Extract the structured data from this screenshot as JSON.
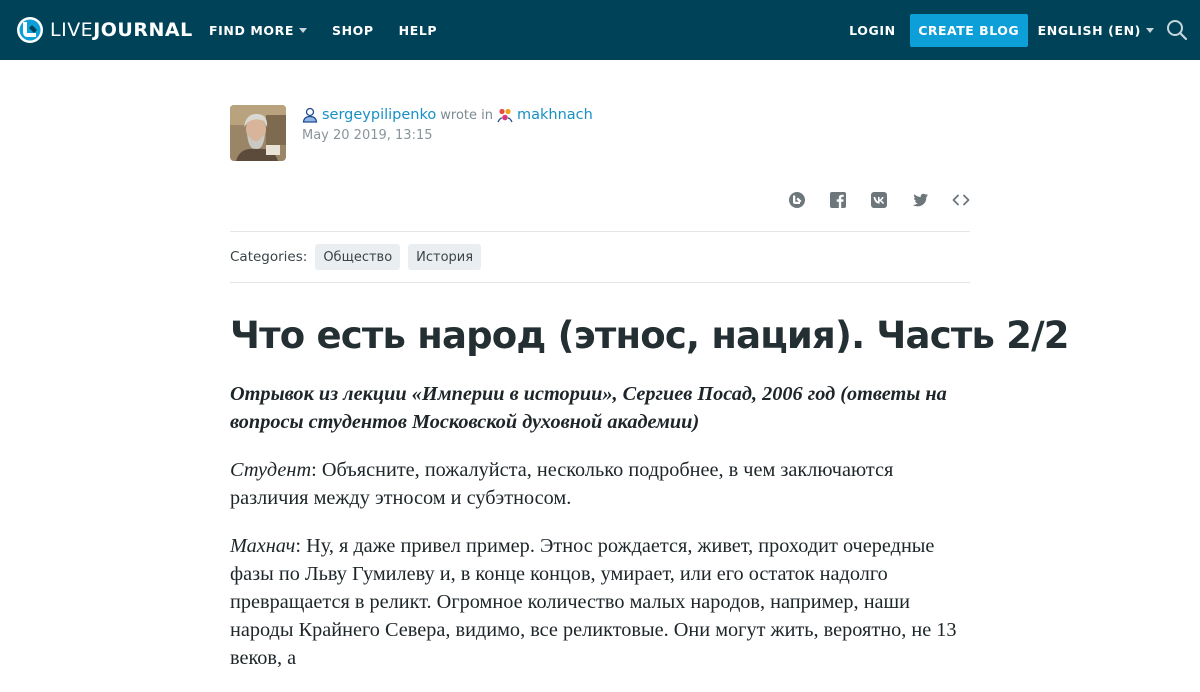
{
  "header": {
    "logo_text_light": "LIVE",
    "logo_text_bold": "JOURNAL",
    "nav": [
      {
        "label": "FIND MORE",
        "has_dropdown": true
      },
      {
        "label": "SHOP",
        "has_dropdown": false
      },
      {
        "label": "HELP",
        "has_dropdown": false
      }
    ],
    "login": "LOGIN",
    "create_blog": "CREATE BLOG",
    "language": "ENGLISH (EN)",
    "bg_color": "#004359",
    "accent_color": "#0d9fd8"
  },
  "post": {
    "author": "sergeypilipenko",
    "wrote_in": "wrote in",
    "community": "makhnach",
    "date": "May 20 2019, 13:15",
    "share_icons": [
      "livejournal-repost-icon",
      "facebook-icon",
      "vk-icon",
      "twitter-icon",
      "embed-code-icon"
    ],
    "categories_label": "Categories:",
    "categories": [
      "Общество",
      "История"
    ],
    "title": "Что есть народ (этнос, нация). Часть 2/2",
    "lead": "Отрывок из лекции «Империи в истории», Сергиев Посад, 2006 год (ответы на вопросы студентов Московской духовной академии)",
    "paragraphs": [
      {
        "speaker": "Студент",
        "text": ": Объясните, пожалуйста, несколько подробнее, в чем заключаются различия между этносом и субэтносом."
      },
      {
        "speaker": "Махнач",
        "text": ": Ну, я даже привел пример. Этнос рождается, живет, проходит очередные фазы по Льву Гумилеву и, в конце концов, умирает, или его остаток надолго превращается в реликт. Огромное количество малых народов, например, наши народы Крайнего Севера, видимо, все реликтовые. Они могут жить, вероятно, не 13 веков, а"
      }
    ]
  }
}
